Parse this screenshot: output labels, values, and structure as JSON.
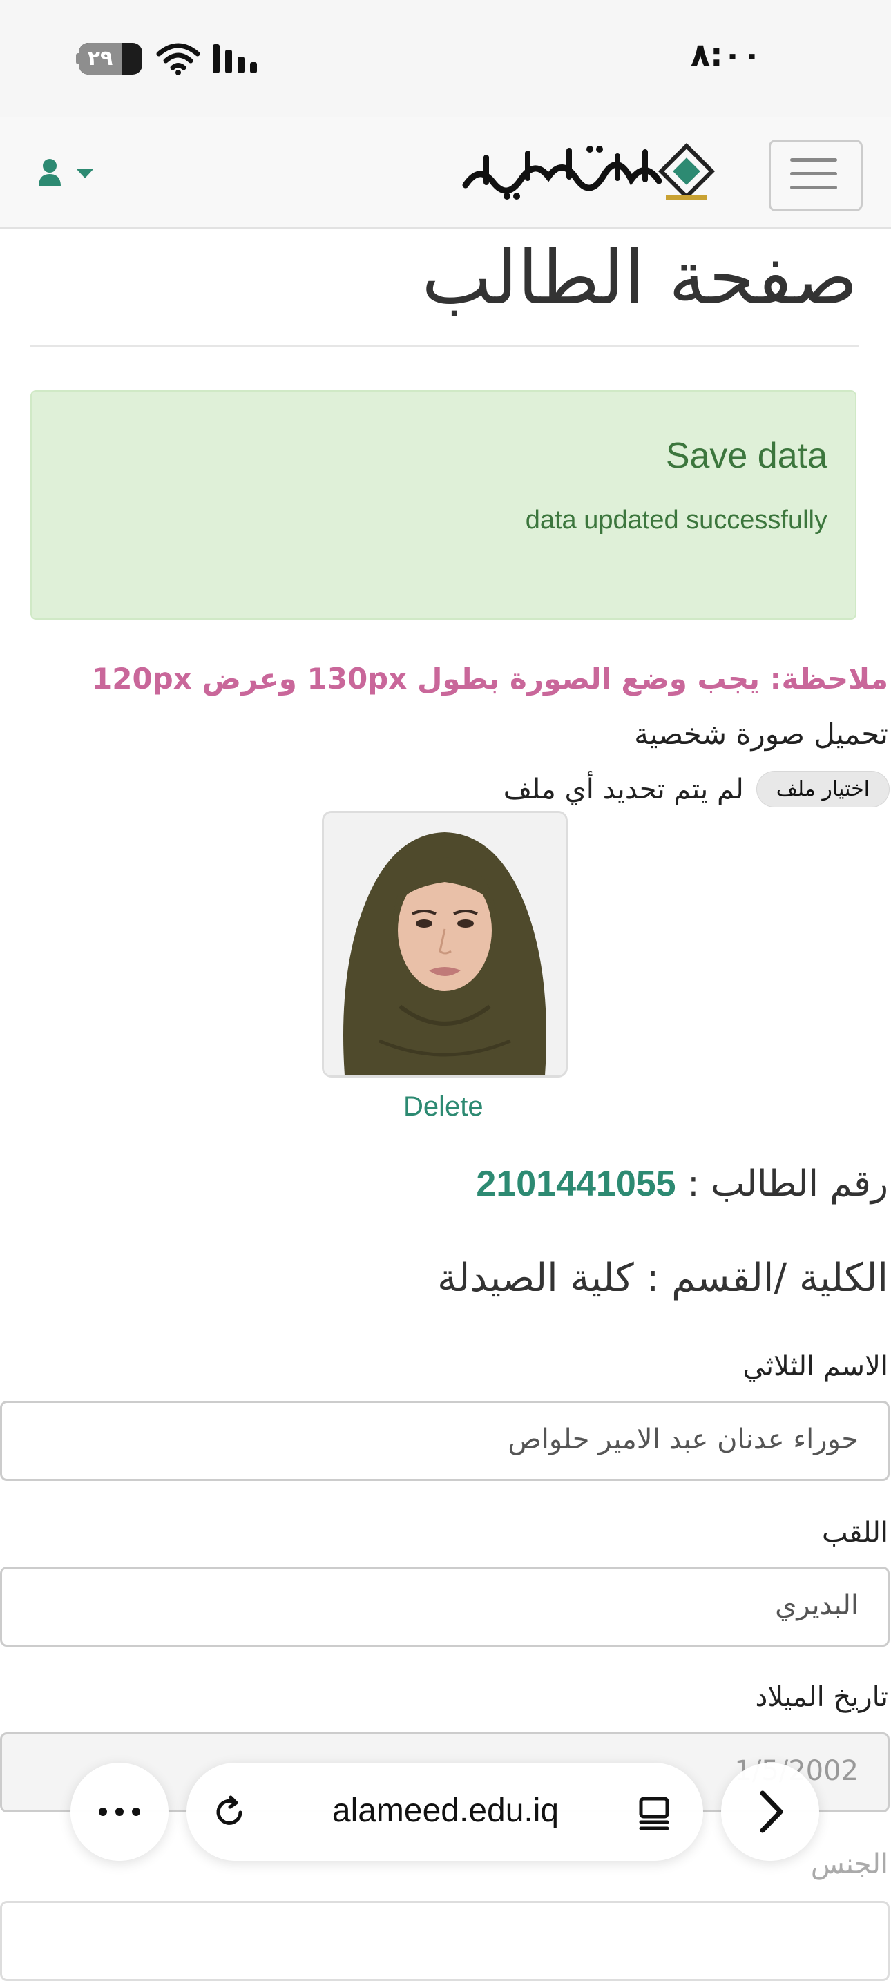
{
  "status_bar": {
    "time": "٨:٠٠",
    "battery": "٢٩"
  },
  "header": {
    "logo_alt": "جامعة العميد",
    "icons": [
      "user-icon",
      "caret-down-icon",
      "hamburger-icon"
    ]
  },
  "page": {
    "title": "صفحة الطالب"
  },
  "alert": {
    "title": "Save data",
    "message": "data updated successfully",
    "color": "#dff0d8"
  },
  "upload": {
    "note": "ملاحظة: يجب وضع الصورة بطول 130px وعرض 120px",
    "label": "تحميل صورة شخصية",
    "choose_button": "اختيار ملف",
    "file_status": "لم يتم تحديد أي ملف",
    "delete_label": "Delete"
  },
  "student": {
    "id_label": "رقم الطالب :",
    "id_value": "2101441055",
    "college_label": "الكلية /القسم :",
    "college_value": "كلية الصيدلة"
  },
  "form": {
    "fullname_label": "الاسم الثلاثي",
    "fullname_value": "حوراء عدنان عبد الامير حلواص",
    "surname_label": "اللقب",
    "surname_value": "البديري",
    "birthdate_label": "تاريخ الميلاد",
    "birthdate_value": "1/5/2002",
    "gender_label": "الجنس"
  },
  "browser": {
    "url": "alameed.edu.iq"
  },
  "colors": {
    "accent": "#2d8a72",
    "note": "#c9679a",
    "alert_text": "#3c763d"
  }
}
